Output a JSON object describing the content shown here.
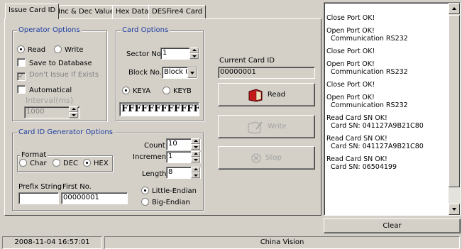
{
  "tabs": [
    {
      "label": "Issue Card ID",
      "active": true
    },
    {
      "label": "Inc & Dec Value",
      "active": false
    },
    {
      "label": "Hex Data",
      "active": false
    },
    {
      "label": "DESFire4 Card",
      "active": false
    }
  ],
  "operator_options": {
    "legend": "Operator Options",
    "read_label": "Read",
    "write_label": "Write",
    "mode": "Read",
    "save_db_label": "Save to Database",
    "dont_issue_label": "Don't Issue If Exists",
    "automatical_label": "Automatical",
    "interval_label": "Interval(ms)",
    "interval_value": "1000"
  },
  "card_options": {
    "legend": "Card Options",
    "sector_label": "Sector No.",
    "sector_value": "1",
    "block_label": "Block No.",
    "block_value": "Block 0",
    "keya_label": "KEYA",
    "keyb_label": "KEYB",
    "key_selected": "KEYA",
    "key_value": "FFFFFFFFFFFF"
  },
  "current_card": {
    "label": "Current Card ID",
    "value": "00000001"
  },
  "buttons": {
    "read": "Read",
    "write": "Write",
    "stop": "Stop",
    "clear": "Clear"
  },
  "generator": {
    "legend": "Card ID Generator Options",
    "format_legend": "Format",
    "char_label": "Char",
    "dec_label": "DEC",
    "hex_label": "HEX",
    "format_selected": "HEX",
    "count_label": "Count",
    "count_value": "10",
    "increment_label": "Increment",
    "increment_value": "1",
    "length_label": "Length",
    "length_value": "8",
    "prefix_label": "Prefix String",
    "prefix_value": "",
    "first_no_label": "First No.",
    "first_no_value": "00000001",
    "little_endian_label": "Little-Endian",
    "big_endian_label": "Big-Endian",
    "endian_selected": "Little-Endian"
  },
  "log": [
    "Close Port OK!",
    "Open Port OK!\n  Communication RS232",
    "Close Port OK!",
    "Open Port OK!\n  Communication RS232",
    "Close Port OK!",
    "Open Port OK!\n  Communication RS232",
    "Read Card SN OK!\n  Card SN: 041127A9B21C80",
    "Read Card SN OK!\n  Card SN: 041127A9B21C80",
    "Read Card SN OK!\n  Card SN: 06504199"
  ],
  "status": {
    "datetime": "2008-11-04 16:57:01",
    "company": "China Vision"
  }
}
